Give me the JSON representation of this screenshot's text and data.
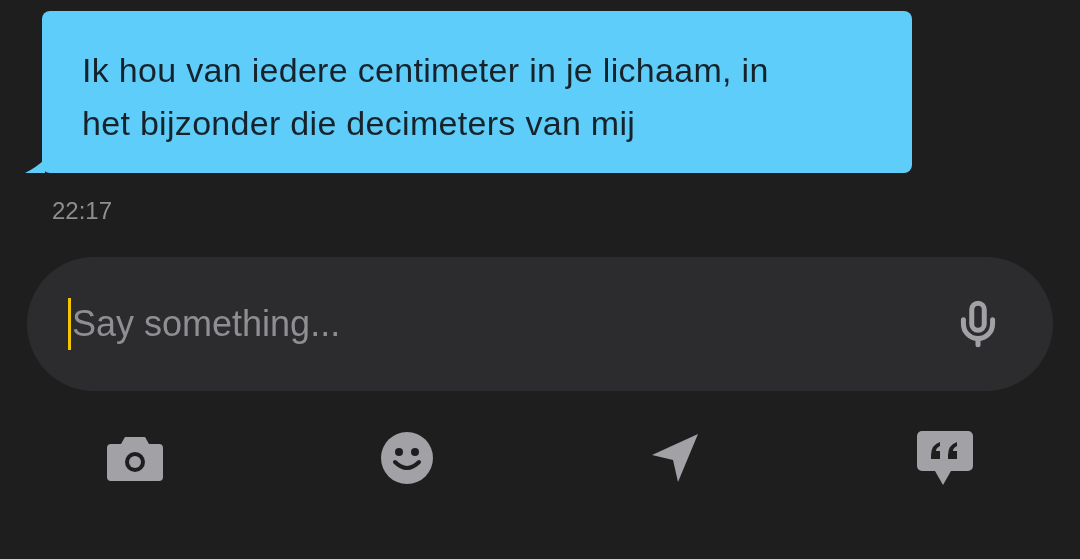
{
  "messages": [
    {
      "text": "Ik hou van iedere centimeter in je lichaam, in het bijzonder die decimeters van mij",
      "time": "22:17"
    }
  ],
  "composer": {
    "placeholder": "Say something..."
  }
}
